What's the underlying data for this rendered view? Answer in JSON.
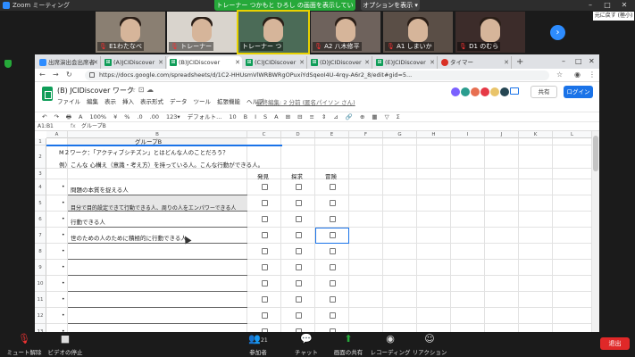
{
  "zoom": {
    "app_title": "Zoom ミーティング",
    "share_banner": "トレーナー つかもと ひろし の画面を表示しています",
    "options_label": "オプションを表示",
    "restore_label": "元に戻す (極小)",
    "participants": [
      {
        "name": "E1わたなべ"
      },
      {
        "name": "トレーナー"
      },
      {
        "name": "トレーナー つ"
      },
      {
        "name": "A2 八木修平"
      },
      {
        "name": "A1 しまいか"
      },
      {
        "name": "D1 のむら"
      }
    ],
    "bottom": {
      "mute": "ミュート解除",
      "video": "ビデオの停止",
      "participants": "参加者",
      "participant_count": "21",
      "chat": "チャット",
      "share": "画面の共有",
      "record": "レコーディング",
      "reactions": "リアクション",
      "end": "退出"
    }
  },
  "browser": {
    "tabs": [
      {
        "label": "出席演出会出席者",
        "icon": "zoom"
      },
      {
        "label": "(A)JCIDiscover",
        "icon": "sheets"
      },
      {
        "label": "(B)JCIDiscover",
        "icon": "sheets",
        "active": true
      },
      {
        "label": "(C)JCIDiscover",
        "icon": "sheets"
      },
      {
        "label": "(D)JCIDiscover",
        "icon": "sheets"
      },
      {
        "label": "(E)JCIDiscover",
        "icon": "sheets"
      },
      {
        "label": "タイマー",
        "icon": "timer"
      }
    ],
    "url": "https://docs.google.com/spreadsheets/d/1C2-HHUsmVlWRBWRgOPuxiYdSqeoI4U-4rqy-A6r2_8/edit#gid=5..."
  },
  "sheet": {
    "title": "(B) JCIDiscover ワーク",
    "menu": [
      "ファイル",
      "編集",
      "表示",
      "挿入",
      "表示形式",
      "データ",
      "ツール",
      "拡張機能",
      "ヘルプ"
    ],
    "last_edit": "最終編集: 2 分前 (匿名パイソン さん)",
    "share_label": "共有",
    "login_label": "ログイン",
    "toolbar": [
      "↶",
      "↷",
      "🖶",
      "A",
      "100%",
      "¥",
      "%",
      ".0",
      ".00",
      "123▾",
      "デフォルト...",
      "10",
      "B",
      "I",
      "S",
      "A",
      "⊞",
      "⊟",
      "≡",
      "⇕",
      "⊿",
      "🔗",
      "⊕",
      "▦",
      "▽",
      "Σ"
    ],
    "cell_ref": "A1:B1",
    "formula_content": "グループB",
    "columns": [
      "A",
      "B",
      "C",
      "D",
      "E",
      "F",
      "G",
      "H",
      "I",
      "J",
      "K",
      "L"
    ],
    "rows": [
      "1",
      "2",
      "3",
      "4",
      "5",
      "6",
      "7",
      "8",
      "9",
      "10",
      "11",
      "12",
      "13"
    ],
    "group_header": "グループB",
    "work_title": "M２ワーク：「アクティブシチズン」とはどんな人のことだろう？",
    "work_example": "例）こんな 心構え（意識・考え方）を持っている人。こんな行動ができる人。",
    "col_headers": [
      "発見",
      "探求",
      "冒険"
    ],
    "entries": [
      "問題の本質を捉える人",
      "目分で目的設定できて行動できる人、周りの人をエンパワーできる人",
      "行動できる人",
      "世のための人のために積極的に行動できる人"
    ]
  }
}
